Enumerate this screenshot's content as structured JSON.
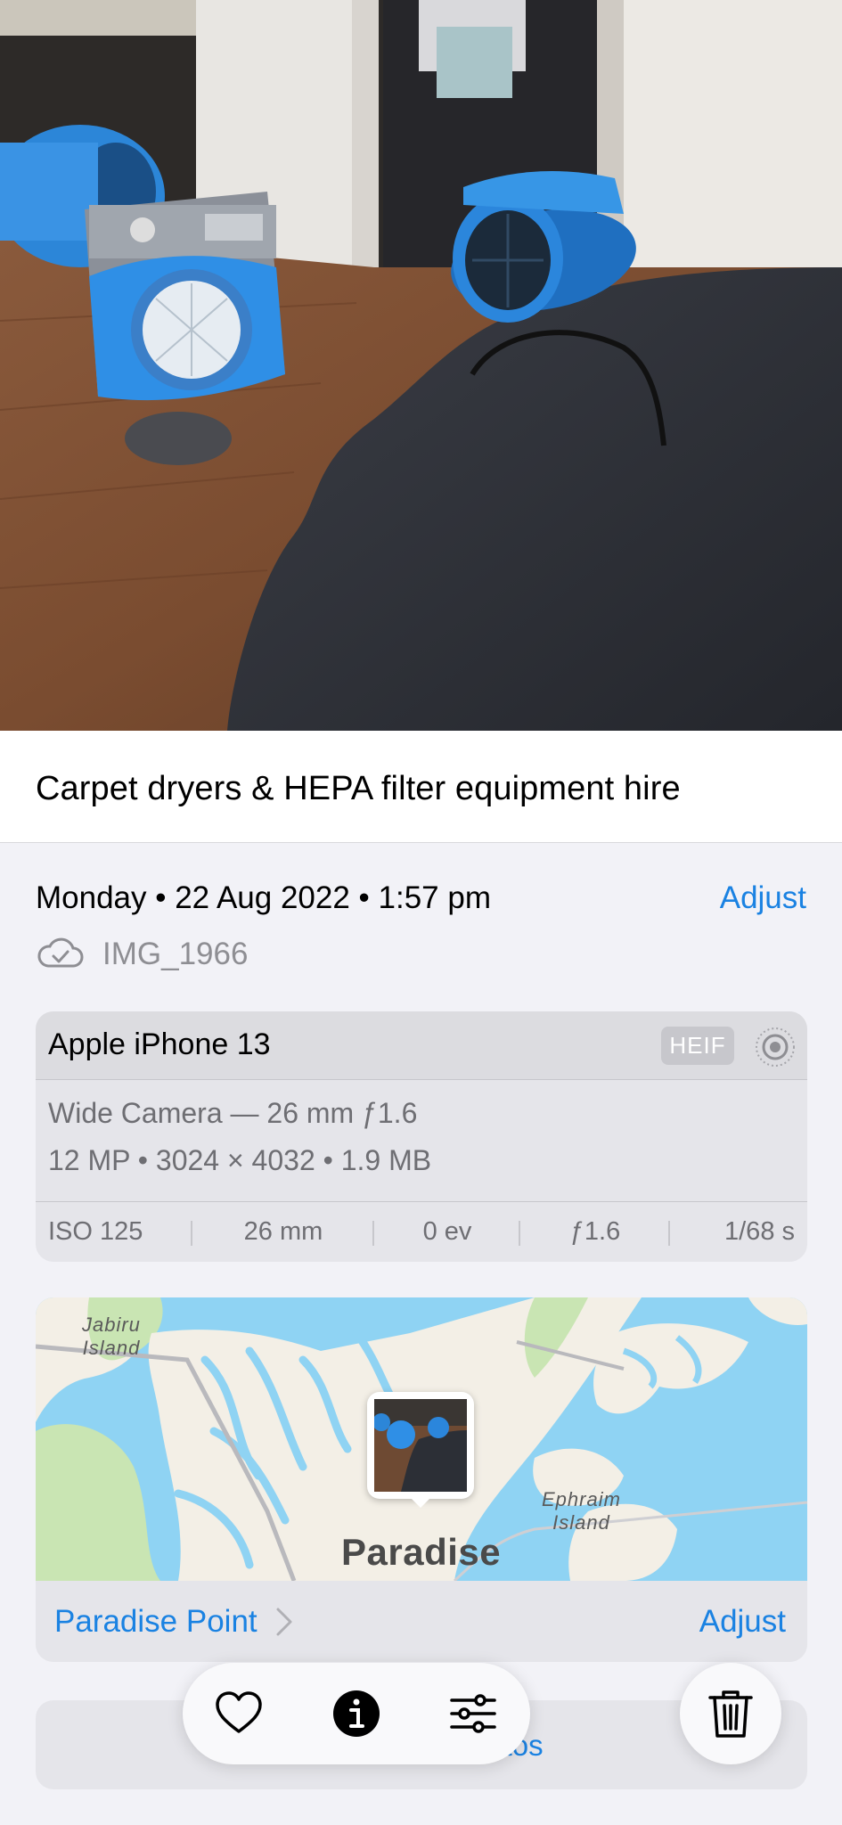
{
  "photo": {
    "description_icon": "photo-image"
  },
  "caption": "Carpet dryers & HEPA filter equipment hire",
  "date_line": "Monday • 22 Aug 2022 • 1:57 pm",
  "adjust_label": "Adjust",
  "filename": "IMG_1966",
  "camera": {
    "device": "Apple iPhone 13",
    "format_badge": "HEIF",
    "lens": "Wide Camera — 26 mm ƒ1.6",
    "resolution": "12 MP • 3024 × 4032 • 1.9 MB",
    "exif": [
      "ISO 125",
      "26 mm",
      "0 ev",
      "ƒ1.6",
      "1/68 s"
    ]
  },
  "map": {
    "labels": {
      "main": "Paradise",
      "jabiru_1": "Jabiru",
      "jabiru_2": "Island",
      "ephraim_1": "Ephraim",
      "ephraim_2": "Island"
    },
    "location": "Paradise Point",
    "adjust_label": "Adjust",
    "colors": {
      "water": "#8fd3f3",
      "land": "#f3efe6",
      "park": "#c9e5b3"
    }
  },
  "show_all": "Show in All Photos",
  "toolbar": {
    "favorite_icon": "heart-icon",
    "info_icon": "info-icon",
    "edit_icon": "sliders-icon",
    "delete_icon": "trash-icon"
  },
  "colors": {
    "accent": "#1a82e2",
    "background": "#f2f2f7"
  }
}
